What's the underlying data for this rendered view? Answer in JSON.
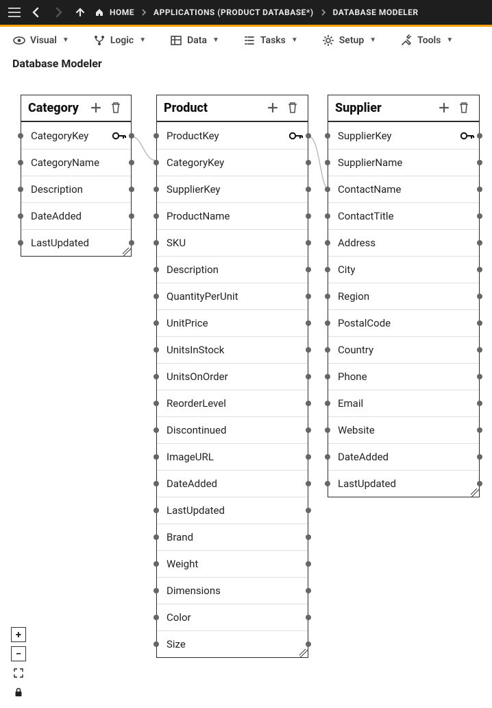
{
  "breadcrumb": {
    "home": "HOME",
    "apps": "APPLICATIONS (PRODUCT DATABASE*)",
    "page": "DATABASE MODELER"
  },
  "toolbar": {
    "visual": "Visual",
    "logic": "Logic",
    "data": "Data",
    "tasks": "Tasks",
    "setup": "Setup",
    "tools": "Tools"
  },
  "page_title": "Database Modeler",
  "entities": {
    "category": {
      "name": "Category",
      "fields": [
        "CategoryKey",
        "CategoryName",
        "Description",
        "DateAdded",
        "LastUpdated"
      ],
      "primary_key": "CategoryKey"
    },
    "product": {
      "name": "Product",
      "fields": [
        "ProductKey",
        "CategoryKey",
        "SupplierKey",
        "ProductName",
        "SKU",
        "Description",
        "QuantityPerUnit",
        "UnitPrice",
        "UnitsInStock",
        "UnitsOnOrder",
        "ReorderLevel",
        "Discontinued",
        "ImageURL",
        "DateAdded",
        "LastUpdated",
        "Brand",
        "Weight",
        "Dimensions",
        "Color",
        "Size"
      ],
      "primary_key": "ProductKey"
    },
    "supplier": {
      "name": "Supplier",
      "fields": [
        "SupplierKey",
        "SupplierName",
        "ContactName",
        "ContactTitle",
        "Address",
        "City",
        "Region",
        "PostalCode",
        "Country",
        "Phone",
        "Email",
        "Website",
        "DateAdded",
        "LastUpdated"
      ],
      "primary_key": "SupplierKey"
    }
  },
  "zoom": {
    "plus": "+",
    "minus": "−"
  }
}
